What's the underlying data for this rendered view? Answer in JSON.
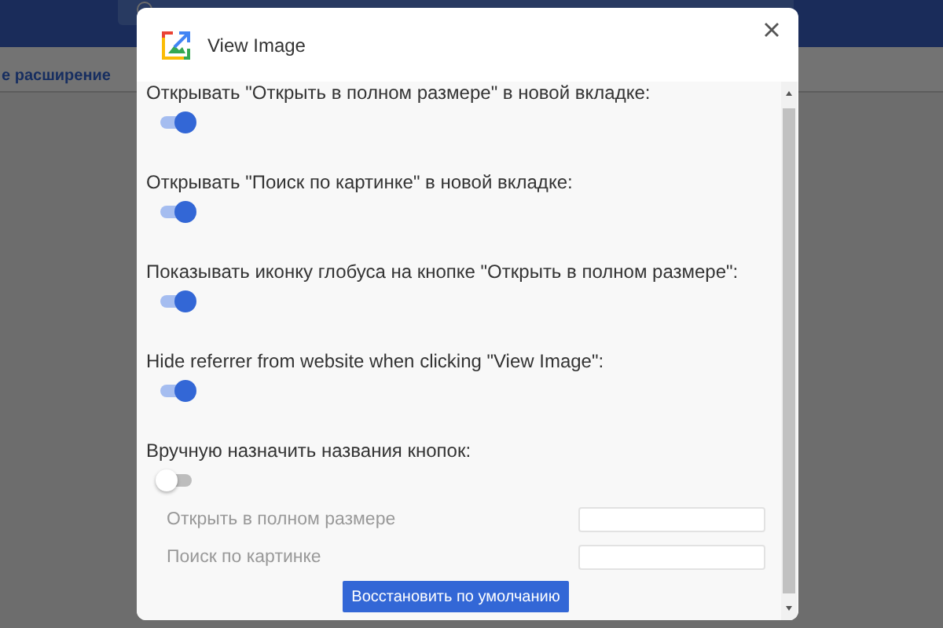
{
  "background": {
    "toolbar_button": "е расширение"
  },
  "dialog": {
    "title": "View Image",
    "options": [
      {
        "label": "Открывать \"Открыть в полном размере\" в новой вкладке:",
        "on": true
      },
      {
        "label": "Открывать \"Поиск по картинке\" в новой вкладке:",
        "on": true
      },
      {
        "label": "Показывать иконку глобуса на кнопке \"Открыть в полном размере\":",
        "on": true
      },
      {
        "label": "Hide referrer from website when clicking \"View Image\":",
        "on": true
      },
      {
        "label": "Вручную назначить названия кнопок:",
        "on": false
      }
    ],
    "fields": [
      {
        "label": "Открыть в полном размере",
        "disabled": true
      },
      {
        "label": "Поиск по картинке",
        "disabled": true
      }
    ],
    "reset_button": "Восстановить по умолчанию"
  }
}
